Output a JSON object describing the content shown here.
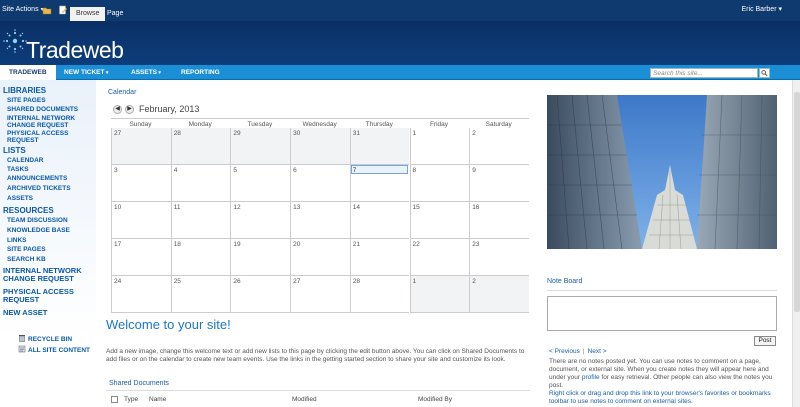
{
  "ribbon": {
    "site_actions": "Site Actions",
    "tabs": [
      "Browse",
      "Page"
    ],
    "user": "Eric Barber"
  },
  "banner": {
    "logo_text": "Tradeweb"
  },
  "topnav": {
    "items": [
      "Tradeweb",
      "New Ticket",
      "Assets",
      "Reporting"
    ],
    "search_placeholder": "Search this site..."
  },
  "leftnav": {
    "libraries_head": "Libraries",
    "libraries": [
      "Site Pages",
      "Shared Documents",
      "Internal Network",
      "Change Request",
      "Physical Access",
      "Request"
    ],
    "lists_head": "Lists",
    "lists": [
      "Calendar",
      "Tasks",
      "Announcements",
      "Archived Tickets",
      "Assets"
    ],
    "resources_head": "Resources",
    "resources": [
      "Team Discussion",
      "Knowledge Base",
      "Links",
      "Site Pages",
      "Search KB"
    ],
    "extra": [
      "Internal Network",
      "Change Request",
      "Physical Access",
      "Request",
      "New Asset"
    ],
    "recycle_bin": "Recycle Bin",
    "all_site_content": "All Site Content"
  },
  "calendar": {
    "title": "Calendar",
    "month": "February, 2013",
    "days": [
      "Sunday",
      "Monday",
      "Tuesday",
      "Wednesday",
      "Thursday",
      "Friday",
      "Saturday"
    ],
    "weeks": [
      [
        "27",
        "28",
        "29",
        "30",
        "31",
        "1",
        "2"
      ],
      [
        "3",
        "4",
        "5",
        "6",
        "7",
        "8",
        "9"
      ],
      [
        "10",
        "11",
        "12",
        "13",
        "14",
        "15",
        "16"
      ],
      [
        "17",
        "18",
        "19",
        "20",
        "21",
        "22",
        "23"
      ],
      [
        "24",
        "25",
        "26",
        "27",
        "28",
        "1",
        "2"
      ]
    ],
    "today": "7"
  },
  "welcome": {
    "title": "Welcome to your site!",
    "text": "Add a new image, change this welcome text or add new lists to this page by clicking the edit button above. You can click on Shared Documents to add files or on the calendar to create new team events. Use the links in the getting started section to share your site and customize its look."
  },
  "shared_docs": {
    "title": "Shared Documents",
    "columns": [
      "Type",
      "Name",
      "Modified",
      "Modified By"
    ]
  },
  "note_board": {
    "title": "Note Board",
    "post": "Post",
    "previous": "< Previous",
    "next": "Next >",
    "info_1": "There are no notes posted yet. You can use notes to comment on a page, document, or external site. When you create notes they will appear here and under your ",
    "info_link": "profile",
    "info_2": " for easy retrieval. Other people can also view the notes you post.",
    "tip": "Right click or drag and drop this link to your browser's favorites or bookmarks toolbar to use notes to comment on external sites."
  }
}
